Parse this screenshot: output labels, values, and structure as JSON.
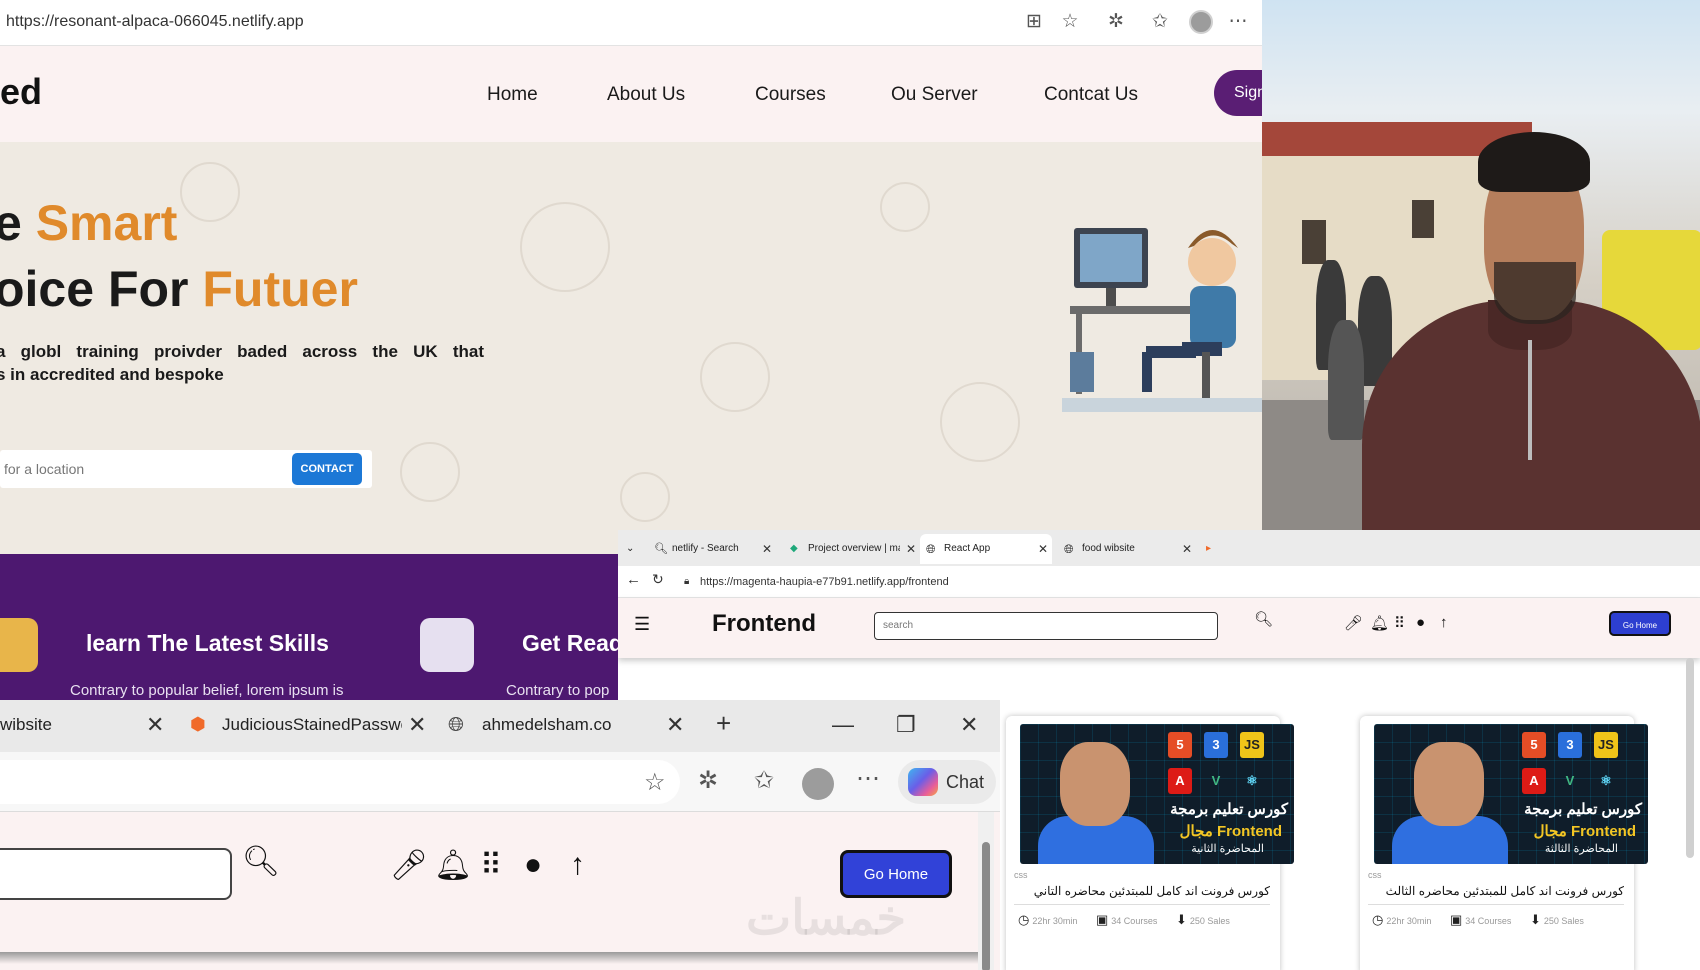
{
  "window_main": {
    "url": "https://resonant-alpaca-066045.netlify.app",
    "brand": "ed",
    "nav": [
      "Home",
      "About Us",
      "Courses",
      "Ou Server",
      "Contcat Us"
    ],
    "sign_label": "Sign",
    "hero": {
      "line1_prefix": "e ",
      "line1_accent": "Smart",
      "line2_prefix": "oice For ",
      "line2_accent": "Futuer",
      "paragraph_line1": "a globl training proivder baded across the UK that",
      "paragraph_line2": "s in accredited and bespoke",
      "search_placeholder": "for a location",
      "contact_label": "CONTACT"
    },
    "band": {
      "items": [
        {
          "title": "learn The Latest Skills",
          "text": "Contrary to popular belief, lorem ipsum is"
        },
        {
          "title": "Get Read",
          "text": "Contrary to pop"
        }
      ]
    }
  },
  "window_frontend": {
    "tabs": [
      {
        "label": "netlify - Search"
      },
      {
        "label": "Project overview | mage"
      },
      {
        "label": "React App"
      },
      {
        "label": "food wibsite"
      }
    ],
    "url": "https://magenta-haupia-e77b91.netlify.app/frontend",
    "brand": "Frontend",
    "search_placeholder": "search",
    "go_home": "Go Home",
    "cards": [
      {
        "category": "css",
        "title": "كورس فرونت اند كامل للمبتدئين محاضره التاني",
        "thumb_line1": "كورس تعليم برمجة",
        "thumb_line2": "مجال Frontend",
        "thumb_line3": "المحاضرة الثانية",
        "duration": "22hr 30min",
        "courses": "34 Courses",
        "sales": "250 Sales"
      },
      {
        "category": "css",
        "title": "كورس فرونت اند كامل للمبتدئين محاضره الثالث",
        "thumb_line1": "كورس تعليم برمجة",
        "thumb_line2": "مجال Frontend",
        "thumb_line3": "المحاضرة الثالثة",
        "duration": "22hr 30min",
        "courses": "34 Courses",
        "sales": "250 Sales"
      }
    ]
  },
  "window_bottom": {
    "tabs": [
      {
        "label": "wibsite"
      },
      {
        "label": "JudiciousStainedPasswor"
      },
      {
        "label": "ahmedelsham.co"
      }
    ],
    "chat_label": "Chat",
    "go_home": "Go Home",
    "watermark": "خمسات"
  },
  "colors": {
    "accent_orange": "#e08a2b",
    "purple_band": "#4d1870",
    "button_blue": "#3142d8",
    "contact_blue": "#1c78d6"
  }
}
